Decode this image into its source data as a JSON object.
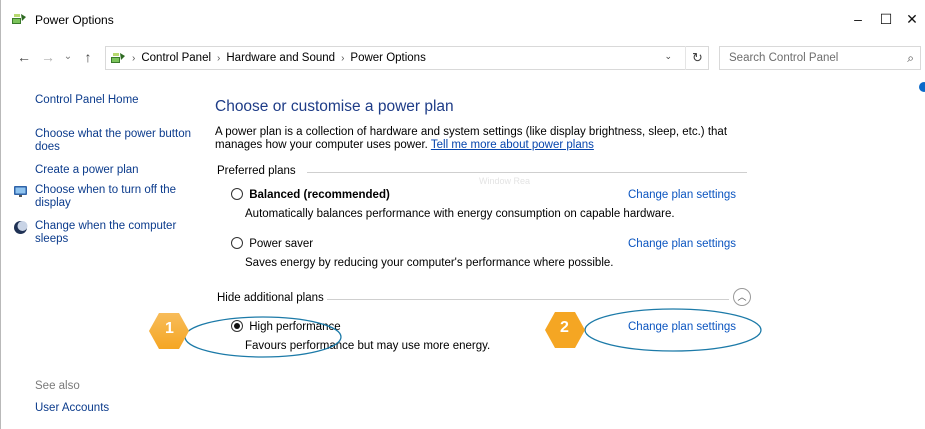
{
  "window": {
    "title": "Power Options",
    "min_glyph": "–",
    "max_glyph": "☐",
    "close_glyph": "✕"
  },
  "nav": {
    "back_glyph": "←",
    "forward_glyph": "→",
    "recent_glyph": "⌄",
    "up_glyph": "↑",
    "breadcrumbs": [
      "Control Panel",
      "Hardware and Sound",
      "Power Options"
    ],
    "separator_glyph": "›",
    "dropdown_glyph": "⌄",
    "refresh_glyph": "↻",
    "search_placeholder": "Search Control Panel",
    "search_glyph": "⌕"
  },
  "left_pane": {
    "home": "Control Panel Home",
    "links": [
      "Choose what the power button does",
      "Create a power plan",
      "Choose when to turn off the display",
      "Change when the computer sleeps"
    ],
    "see_also_label": "See also",
    "see_also_links": [
      "User Accounts"
    ]
  },
  "main": {
    "title": "Choose or customise a power plan",
    "intro_text": "A power plan is a collection of hardware and system settings (like display brightness, sleep, etc.) that manages how your computer uses power.",
    "intro_link": "Tell me more about power plans",
    "preferred_header": "Preferred plans",
    "additional_header": "Hide additional plans",
    "collapse_glyph": "︿",
    "watermark": "Window Rea",
    "plans": [
      {
        "name": "Balanced (recommended)",
        "description": "Automatically balances performance with energy consumption on capable hardware.",
        "selected": false,
        "link": "Change plan settings"
      },
      {
        "name": "Power saver",
        "description": "Saves energy by reducing your computer's performance where possible.",
        "selected": false,
        "link": "Change plan settings"
      },
      {
        "name": "High performance",
        "description": "Favours performance but may use more energy.",
        "selected": true,
        "link": "Change plan settings"
      }
    ]
  },
  "callouts": {
    "one": "1",
    "two": "2",
    "fill_color": "#f5a623",
    "ellipse_color": "#1c7aa8"
  },
  "colors": {
    "link": "#0b55c0",
    "title": "#1e3c87",
    "accent_dot": "#0a69c9"
  }
}
